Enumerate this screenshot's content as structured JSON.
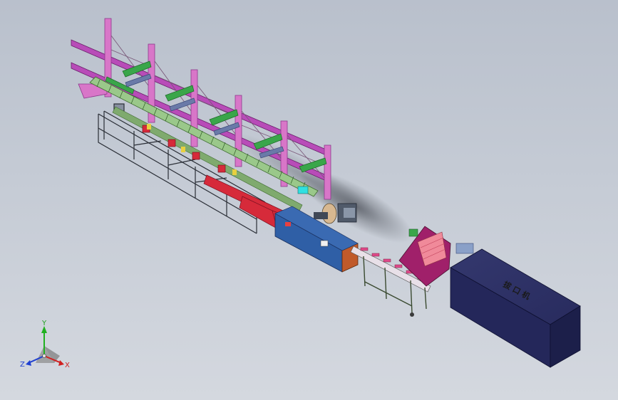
{
  "model": {
    "machine_label": "拔 口 机"
  },
  "triad": {
    "x_label": "X",
    "y_label": "Y",
    "z_label": "Z"
  },
  "colors": {
    "background_top": "#b9c0cc",
    "background_bottom": "#d4d8df",
    "rack_pink": "#d876c8",
    "beam_magenta": "#a03aa6",
    "arm_green": "#3aa64a",
    "frame_dark": "#2a2e36",
    "conveyor_red": "#d62a3a",
    "cabinet_blue": "#2f5fa6",
    "machine_navy": "#24275a",
    "axis_x": "#d02020",
    "axis_y": "#20b020",
    "axis_z": "#2040d0"
  }
}
